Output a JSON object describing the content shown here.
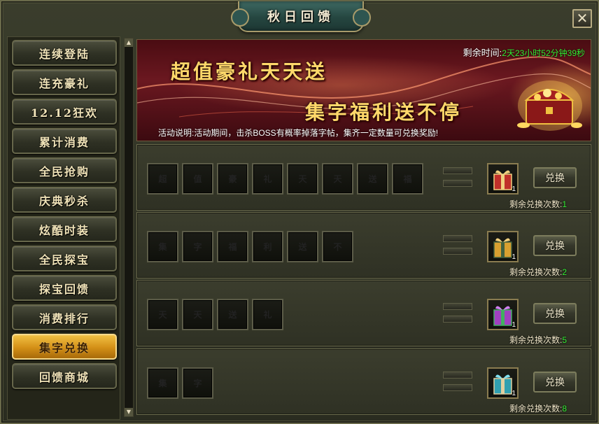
{
  "window": {
    "title": "秋日回馈",
    "close_glyph": "✕"
  },
  "sidebar": {
    "items": [
      {
        "label": "连续登陆",
        "active": false
      },
      {
        "label": "连充豪礼",
        "active": false
      },
      {
        "label": "12.12狂欢",
        "active": false
      },
      {
        "label": "累计消费",
        "active": false
      },
      {
        "label": "全民抢购",
        "active": false
      },
      {
        "label": "庆典秒杀",
        "active": false
      },
      {
        "label": "炫酷时装",
        "active": false
      },
      {
        "label": "全民探宝",
        "active": false
      },
      {
        "label": "探宝回馈",
        "active": false
      },
      {
        "label": "消费排行",
        "active": false
      },
      {
        "label": "集字兑换",
        "active": true
      },
      {
        "label": "回馈商城",
        "active": false
      }
    ]
  },
  "banner": {
    "line1": "超值豪礼天天送",
    "line2": "集字福利送不停",
    "timer_label": "剩余时间:",
    "timer_value": "2天23小时52分钟39秒",
    "desc_label": "活动说明:",
    "desc_text": "活动期间，击杀BOSS有概率掉落字帖，集齐一定数量可兑换奖励!"
  },
  "rows": [
    {
      "glyphs": [
        "超",
        "值",
        "豪",
        "礼",
        "天",
        "天",
        "送",
        "福"
      ],
      "reward_count": "1",
      "reward_color": "#c0302a",
      "button": "兑换",
      "remain_label": "剩余兑换次数:",
      "remain_value": "1"
    },
    {
      "glyphs": [
        "集",
        "字",
        "福",
        "利",
        "送",
        "不"
      ],
      "reward_count": "1",
      "reward_color": "#d8a030",
      "button": "兑换",
      "remain_label": "剩余兑换次数:",
      "remain_value": "2"
    },
    {
      "glyphs": [
        "天",
        "天",
        "送",
        "礼"
      ],
      "reward_count": "1",
      "reward_color": "#a040c0",
      "button": "兑换",
      "remain_label": "剩余兑换次数:",
      "remain_value": "5"
    },
    {
      "glyphs": [
        "集",
        "字"
      ],
      "reward_count": "1",
      "reward_color": "#30a0b0",
      "button": "兑换",
      "remain_label": "剩余兑换次数:",
      "remain_value": "8"
    }
  ],
  "scrollbar": {
    "up": "▲",
    "down": "▼"
  }
}
